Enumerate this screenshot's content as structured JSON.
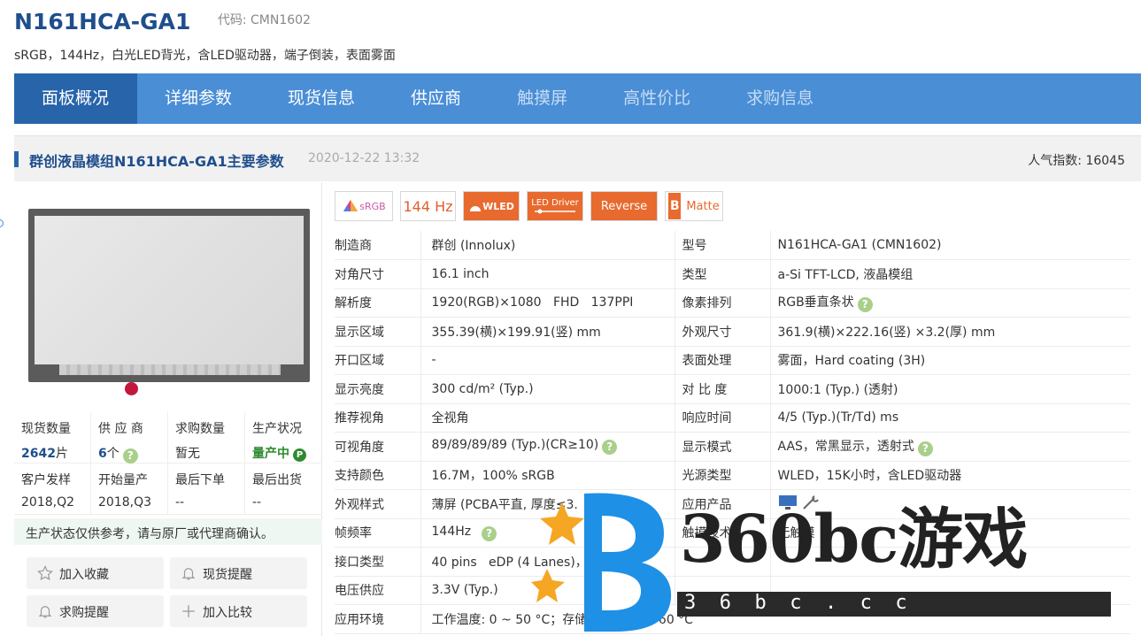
{
  "header": {
    "model": "N161HCA-GA1",
    "code_label": "代码: CMN1602",
    "subtitle": "sRGB，144Hz，白光LED背光，含LED驱动器，端子倒装，表面雾面"
  },
  "nav": {
    "tabs": [
      "面板概况",
      "详细参数",
      "现货信息",
      "供应商",
      "触摸屏",
      "高性价比",
      "求购信息"
    ]
  },
  "section": {
    "title": "群创液晶模组N161HCA-GA1主要参数",
    "date": "2020-12-22 13:32",
    "popularity": "人气指数:  16045"
  },
  "stats": {
    "row1": [
      {
        "label": "现货数量",
        "value": "2642",
        "unit": "片"
      },
      {
        "label": "供 应 商",
        "value": "6",
        "unit": "个"
      },
      {
        "label": "求购数量",
        "value": "暂无"
      },
      {
        "label": "生产状况",
        "value": "量产中"
      }
    ],
    "row2": [
      {
        "label": "客户发样",
        "value": "2018,Q2"
      },
      {
        "label": "开始量产",
        "value": "2018,Q3"
      },
      {
        "label": "最后下单",
        "value": "--"
      },
      {
        "label": "最后出货",
        "value": "--"
      }
    ],
    "notice": "生产状态仅供参考，请与原厂或代理商确认。"
  },
  "buttons": {
    "favorite": "加入收藏",
    "stock_alert": "现货提醒",
    "purchase_alert": "求购提醒",
    "compare": "加入比较"
  },
  "features": {
    "srgb": "sRGB",
    "hz": "144 Hz",
    "wled": "WLED",
    "led_driver": "LED Driver",
    "reverse": "Reverse",
    "matte": "Matte"
  },
  "specs": [
    {
      "k1": "制造商",
      "v1": "群创 (Innolux)",
      "k2": "型号",
      "v2": "N161HCA-GA1 (CMN1602)"
    },
    {
      "k1": "对角尺寸",
      "v1": "16.1 inch",
      "k2": "类型",
      "v2": "a-Si TFT-LCD, 液晶模组"
    },
    {
      "k1": "解析度",
      "v1": "1920(RGB)×1080   FHD   137PPI",
      "k2": "像素排列",
      "v2": "RGB垂直条状"
    },
    {
      "k1": "显示区域",
      "v1": "355.39(横)×199.91(竖) mm",
      "k2": "外观尺寸",
      "v2": "361.9(横)×222.16(竖) ×3.2(厚) mm"
    },
    {
      "k1": "开口区域",
      "v1": "-",
      "k2": "表面处理",
      "v2": "雾面，Hard coating (3H)"
    },
    {
      "k1": "显示亮度",
      "v1": "300 cd/m² (Typ.)",
      "k2": "对 比 度",
      "v2": "1000:1 (Typ.) (透射)"
    },
    {
      "k1": "推荐视角",
      "v1": "全视角",
      "k2": "响应时间",
      "v2": "4/5 (Typ.)(Tr/Td) ms"
    },
    {
      "k1": "可视角度",
      "v1": "89/89/89/89 (Typ.)(CR≥10)",
      "k2": "显示模式",
      "v2": "AAS，常黑显示，透射式"
    },
    {
      "k1": "支持颜色",
      "v1": "16.7M，100% sRGB",
      "k2": "光源类型",
      "v2": "WLED，15K小时，含LED驱动器"
    },
    {
      "k1": "外观样式",
      "v1": "薄屏 (PCBA平直, 厚度≤3.",
      "k2": "应用产品",
      "v2": ""
    },
    {
      "k1": "帧频率",
      "v1": "144Hz",
      "k2": "触摸技术",
      "v2": "无触摸"
    },
    {
      "k1": "接口类型",
      "v1": "40 pins   eDP (4 Lanes)，端子",
      "k2": "",
      "v2": ""
    },
    {
      "k1": "电压供应",
      "v1": "3.3V (Typ.)",
      "k2": "",
      "v2": ""
    },
    {
      "k1": "应用环境",
      "v1": "工作温度: 0 ~ 50 °C；存储温度: -20 ~ 60 °C",
      "k2": "",
      "v2": ""
    }
  ],
  "watermark": {
    "main": "360bc游戏",
    "sub": "3  6  b  c  .  c  c"
  },
  "colors": {
    "nav_bg": "#4a8ed6",
    "nav_active": "#2864aa",
    "title_blue": "#1f4e8c",
    "feature_orange": "#e86a2e"
  }
}
